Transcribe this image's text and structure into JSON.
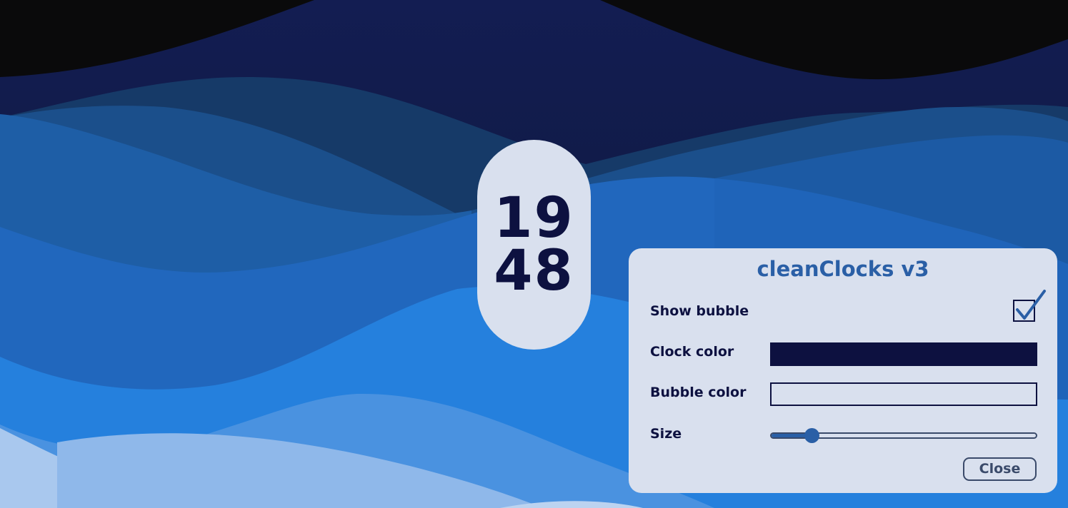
{
  "clock": {
    "hours": "19",
    "minutes": "48"
  },
  "panel": {
    "title": "cleanClocks v3",
    "show_bubble_label": "Show bubble",
    "show_bubble_checked": true,
    "clock_color_label": "Clock color",
    "clock_color_value": "#0d1140",
    "bubble_color_label": "Bubble color",
    "bubble_color_value": "#d9e0ee",
    "size_label": "Size",
    "size_value_fraction": 0.155,
    "close_label": "Close"
  },
  "colors": {
    "accent": "#2a5fa6",
    "text_dark": "#0d1140",
    "panel_bg": "#d9e0ee"
  },
  "icons": {
    "checkbox": "checkmark-icon"
  }
}
